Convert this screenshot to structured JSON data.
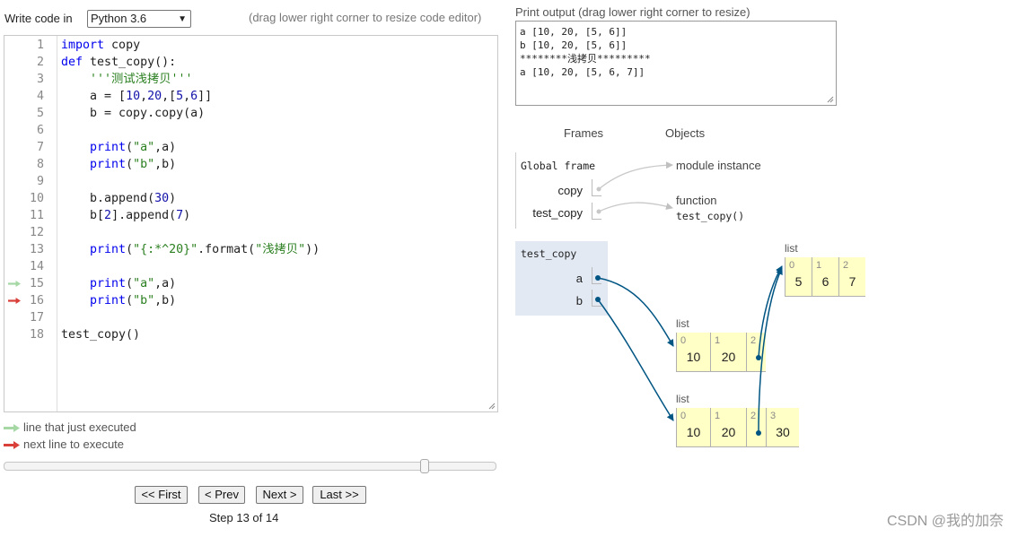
{
  "editor": {
    "write_label": "Write code in",
    "language": "Python 3.6",
    "drag_hint": "(drag lower right corner to resize code editor)",
    "lines": [
      {
        "n": "1",
        "code": "import copy"
      },
      {
        "n": "2",
        "code": "def test_copy():"
      },
      {
        "n": "3",
        "code": "    '''测试浅拷贝'''"
      },
      {
        "n": "4",
        "code": "    a = [10,20,[5,6]]"
      },
      {
        "n": "5",
        "code": "    b = copy.copy(a)"
      },
      {
        "n": "6",
        "code": ""
      },
      {
        "n": "7",
        "code": "    print(\"a\",a)"
      },
      {
        "n": "8",
        "code": "    print(\"b\",b)"
      },
      {
        "n": "9",
        "code": ""
      },
      {
        "n": "10",
        "code": "    b.append(30)"
      },
      {
        "n": "11",
        "code": "    b[2].append(7)"
      },
      {
        "n": "12",
        "code": ""
      },
      {
        "n": "13",
        "code": "    print(\"{:*^20}\".format(\"浅拷贝\"))"
      },
      {
        "n": "14",
        "code": ""
      },
      {
        "n": "15",
        "code": "    print(\"a\",a)"
      },
      {
        "n": "16",
        "code": "    print(\"b\",b)"
      },
      {
        "n": "17",
        "code": ""
      },
      {
        "n": "18",
        "code": "test_copy()"
      }
    ],
    "just_executed_line": 15,
    "next_line": 16
  },
  "legend": {
    "just_executed": "line that just executed",
    "next_to_execute": "next line to execute",
    "green": "#a6d8a6",
    "red": "#d9403a"
  },
  "navigation": {
    "first": "<< First",
    "prev": "< Prev",
    "next": "Next >",
    "last": "Last >>",
    "step_text": "Step 13 of 14",
    "step_current": 13,
    "step_total": 14
  },
  "output": {
    "label": "Print output (drag lower right corner to resize)",
    "lines": [
      "a [10, 20, [5, 6]]",
      "b [10, 20, [5, 6]]",
      "********浅拷贝*********",
      "a [10, 20, [5, 6, 7]]"
    ]
  },
  "viz": {
    "frames_header": "Frames",
    "objects_header": "Objects",
    "global_frame": {
      "title": "Global frame",
      "vars": [
        "copy",
        "test_copy"
      ]
    },
    "global_objects": {
      "module": "module instance",
      "function_label": "function",
      "function_name": "test_copy()"
    },
    "active_frame": {
      "title": "test_copy",
      "vars": [
        "a",
        "b"
      ],
      "bg": "#e2e9f3"
    },
    "lists": {
      "inner": {
        "label": "list",
        "items": [
          {
            "i": "0",
            "v": "5"
          },
          {
            "i": "1",
            "v": "6"
          },
          {
            "i": "2",
            "v": "7"
          }
        ]
      },
      "a_list": {
        "label": "list",
        "items": [
          {
            "i": "0",
            "v": "10"
          },
          {
            "i": "1",
            "v": "20"
          },
          {
            "i": "2",
            "v": ""
          }
        ]
      },
      "b_list": {
        "label": "list",
        "items": [
          {
            "i": "0",
            "v": "10"
          },
          {
            "i": "1",
            "v": "20"
          },
          {
            "i": "2",
            "v": ""
          },
          {
            "i": "3",
            "v": "30"
          }
        ]
      }
    },
    "pointer_color": "#005583",
    "cell_bg": "#ffffc6"
  },
  "watermark": "CSDN @我的加奈"
}
